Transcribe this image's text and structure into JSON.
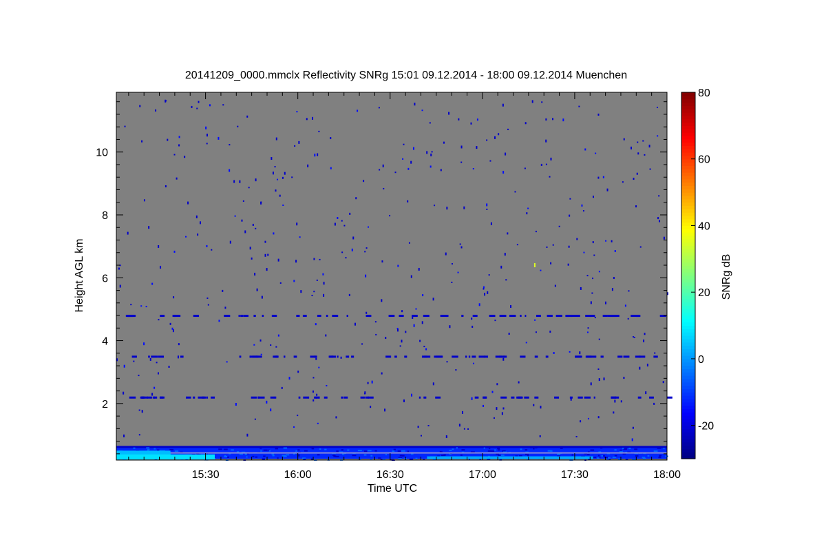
{
  "chart_data": {
    "type": "heatmap",
    "title": "20141209_0000.mmclx Reflectivity SNRg   15:01 09.12.2014 - 18:00 09.12.2014 Muenchen",
    "xlabel": "Time UTC",
    "ylabel": "Height AGL km",
    "x_range": [
      "15:01",
      "18:00"
    ],
    "xlim_hours": [
      15.0167,
      18.0
    ],
    "x_ticks": [
      {
        "hour": 15.5,
        "label": "15:30"
      },
      {
        "hour": 16.0,
        "label": "16:00"
      },
      {
        "hour": 16.5,
        "label": "16:30"
      },
      {
        "hour": 17.0,
        "label": "17:00"
      },
      {
        "hour": 17.5,
        "label": "17:30"
      },
      {
        "hour": 18.0,
        "label": "18:00"
      }
    ],
    "ylim_km": [
      0.2,
      11.9
    ],
    "y_ticks": [
      2,
      4,
      6,
      8,
      10
    ],
    "y_tick_labels": [
      "2",
      "4",
      "6",
      "8",
      "10"
    ],
    "colorbar": {
      "label": "SNRg dB",
      "range": [
        -30,
        80
      ],
      "ticks": [
        -20,
        0,
        20,
        40,
        60,
        80
      ],
      "tick_labels": [
        "-20",
        "0",
        "20",
        "40",
        "60",
        "80"
      ]
    },
    "background_color": "#808080",
    "features": {
      "near_surface_echo_top_km": 0.65,
      "strong_echo_end_hour": 15.55,
      "clutter_layers_km": [
        4.8,
        3.5,
        2.2
      ],
      "isolated_echo": {
        "hour": 17.28,
        "height_km": 6.4,
        "snr_db": 35
      }
    }
  }
}
